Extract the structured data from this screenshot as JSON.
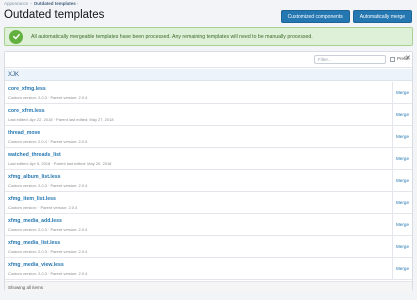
{
  "breadcrumb": {
    "parent": "Appearance",
    "current": "Outdated templates",
    "chevron": "›"
  },
  "page_title": "Outdated templates",
  "buttons": {
    "customized_components": "Customized components",
    "automatically_merge": "Automatically merge"
  },
  "notice": {
    "icon": "check-circle-icon",
    "text": "All automatically mergeable templates have been processed. Any remaining templates will need to be manually processed."
  },
  "filter": {
    "placeholder": "Filter...",
    "prefix_label": "Prefix",
    "clear_glyph": "✕"
  },
  "group": {
    "name": "XJK"
  },
  "templates": [
    {
      "name": "core_xfmg.less",
      "meta": "Custom version: 2.0.3 · Parent version: 2.0.4",
      "action": "Merge"
    },
    {
      "name": "core_xfrm.less",
      "meta": "Last edited: Apr 22, 2018 · Parent last edited: May 27, 2018",
      "action": "Merge"
    },
    {
      "name": "thread_move",
      "meta": "Custom version: 2.0.4 · Parent version: 2.0.5",
      "action": "Merge"
    },
    {
      "name": "watched_threads_list",
      "meta": "Last edited: Apr 5, 2018 · Parent last edited: May 20, 2018",
      "action": "Merge"
    },
    {
      "name": "xfmg_album_list.less",
      "meta": "Custom version: 2.0.3 · Parent version: 2.0.4",
      "action": "Merge"
    },
    {
      "name": "xfmg_item_list.less",
      "meta": "Custom version: · Parent version: 2.0.4",
      "action": "Merge"
    },
    {
      "name": "xfmg_media_add.less",
      "meta": "Custom version: 2.0.3 · Parent version: 2.0.4",
      "action": "Merge"
    },
    {
      "name": "xfmg_media_list.less",
      "meta": "Custom version: 2.0.3 · Parent version: 2.0.4",
      "action": "Merge"
    },
    {
      "name": "xfmg_media_view.less",
      "meta": "Custom version: 2.0.3 · Parent version: 2.0.4",
      "action": "Merge"
    }
  ],
  "footer": {
    "text": "Showing all items"
  }
}
